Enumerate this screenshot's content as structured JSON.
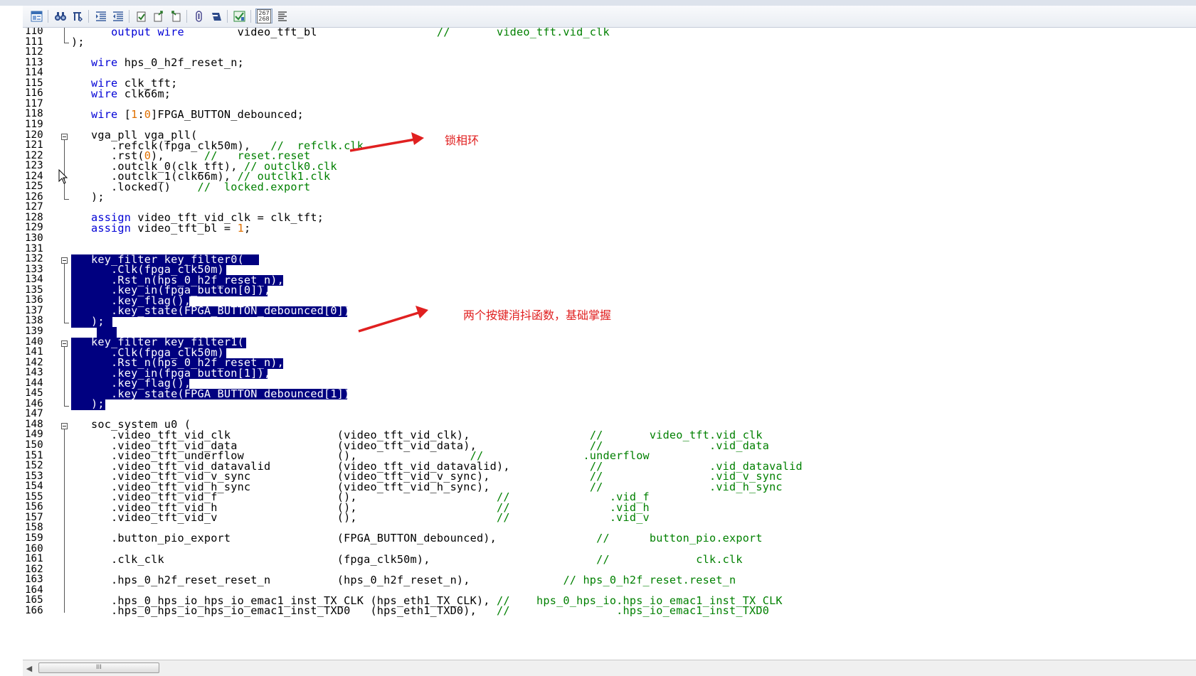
{
  "toolbar": {
    "buttons": [
      {
        "name": "project-icon",
        "color": "#3a6fb5"
      },
      {
        "name": "find-icon",
        "color": "#2c4a8a"
      },
      {
        "name": "find-replace-icon",
        "color": "#2c4a8a"
      },
      {
        "name": "indent-icon",
        "color": "#3a5fa0"
      },
      {
        "name": "unindent-icon",
        "color": "#3a5fa0"
      },
      {
        "name": "bookmark-icon",
        "color": "#2a7a2a"
      },
      {
        "name": "bookmark-next-icon",
        "color": "#2a7a2a"
      },
      {
        "name": "bookmark-prev-icon",
        "color": "#2a7a2a"
      },
      {
        "name": "insert-template-icon",
        "color": "#4a4a90"
      },
      {
        "name": "block-comment-icon",
        "color": "#2c4a8a"
      },
      {
        "name": "check-syntax-icon",
        "color": "#2a8a3a"
      },
      {
        "name": "line-numbers-icon",
        "color": "#333"
      },
      {
        "name": "word-wrap-icon",
        "color": "#333"
      }
    ],
    "line_numbers_label_top": "267",
    "line_numbers_label_bottom": "268"
  },
  "editor": {
    "line_numbers": [
      "110",
      "111",
      "112",
      "113",
      "114",
      "115",
      "116",
      "117",
      "118",
      "119",
      "120",
      "121",
      "122",
      "123",
      "124",
      "125",
      "126",
      "127",
      "128",
      "129",
      "130",
      "131",
      "132",
      "133",
      "134",
      "135",
      "136",
      "137",
      "138",
      "139",
      "140",
      "141",
      "142",
      "143",
      "144",
      "145",
      "146",
      "147",
      "148",
      "149",
      "150",
      "151",
      "152",
      "153",
      "154",
      "155",
      "156",
      "157",
      "158",
      "159",
      "160",
      "161",
      "162",
      "163",
      "164",
      "165",
      "166"
    ],
    "lines": [
      [
        {
          "t": "      ",
          "c": ""
        },
        {
          "t": "output wire",
          "c": "kw"
        },
        {
          "t": "        video_tft_bl                  ",
          "c": ""
        },
        {
          "t": "//       video_tft.vid_clk",
          "c": "cm"
        }
      ],
      [
        {
          "t": ");",
          "c": ""
        }
      ],
      [],
      [
        {
          "t": "   ",
          "c": ""
        },
        {
          "t": "wire",
          "c": "kw"
        },
        {
          "t": " hps_0_h2f_reset_n;",
          "c": ""
        }
      ],
      [],
      [
        {
          "t": "   ",
          "c": ""
        },
        {
          "t": "wire",
          "c": "kw"
        },
        {
          "t": " clk_tft;",
          "c": ""
        }
      ],
      [
        {
          "t": "   ",
          "c": ""
        },
        {
          "t": "wire",
          "c": "kw"
        },
        {
          "t": " clk66m;",
          "c": ""
        }
      ],
      [],
      [
        {
          "t": "   ",
          "c": ""
        },
        {
          "t": "wire",
          "c": "kw"
        },
        {
          "t": " [",
          "c": ""
        },
        {
          "t": "1",
          "c": "nm"
        },
        {
          "t": ":",
          "c": ""
        },
        {
          "t": "0",
          "c": "nm"
        },
        {
          "t": "]FPGA_BUTTON_debounced;",
          "c": ""
        }
      ],
      [],
      [
        {
          "t": "   vga_pll vga_pll(",
          "c": ""
        }
      ],
      [
        {
          "t": "      .refclk(fpga_clk50m),   ",
          "c": ""
        },
        {
          "t": "//  refclk.clk",
          "c": "cm"
        }
      ],
      [
        {
          "t": "      .rst(",
          "c": ""
        },
        {
          "t": "0",
          "c": "nm"
        },
        {
          "t": "),      ",
          "c": ""
        },
        {
          "t": "//   reset.reset",
          "c": "cm"
        }
      ],
      [
        {
          "t": "      .outclk_0(clk_tft), ",
          "c": ""
        },
        {
          "t": "// outclk0.clk",
          "c": "cm"
        }
      ],
      [
        {
          "t": "      .outclk_1(clk66m), ",
          "c": ""
        },
        {
          "t": "// outclk1.clk",
          "c": "cm"
        }
      ],
      [
        {
          "t": "      .locked()    ",
          "c": ""
        },
        {
          "t": "//  locked.export",
          "c": "cm"
        }
      ],
      [
        {
          "t": "   );",
          "c": ""
        }
      ],
      [],
      [
        {
          "t": "   ",
          "c": ""
        },
        {
          "t": "assign",
          "c": "kw"
        },
        {
          "t": " video_tft_vid_clk = clk_tft;",
          "c": ""
        }
      ],
      [
        {
          "t": "   ",
          "c": ""
        },
        {
          "t": "assign",
          "c": "kw"
        },
        {
          "t": " video_tft_bl = ",
          "c": ""
        },
        {
          "t": "1",
          "c": "nm"
        },
        {
          "t": ";",
          "c": ""
        }
      ],
      [],
      [],
      [
        {
          "t": "   key_filter key_filter0(",
          "c": "selx"
        }
      ],
      [
        {
          "t": "      .Clk(fpga_clk50m),",
          "c": "selx"
        }
      ],
      [
        {
          "t": "      .Rst_n(hps_0_h2f_reset_n),",
          "c": "selx"
        }
      ],
      [
        {
          "t": "      .key_in(fpga_button[0]),",
          "c": "selx"
        }
      ],
      [
        {
          "t": "      .key_flag(),",
          "c": "selx"
        }
      ],
      [
        {
          "t": "      .key_state(FPGA_BUTTON_debounced[0])",
          "c": "selx"
        }
      ],
      [
        {
          "t": "   );",
          "c": "selx"
        }
      ],
      [],
      [
        {
          "t": "   key_filter key_filter1(",
          "c": "selx"
        }
      ],
      [
        {
          "t": "      .Clk(fpga_clk50m),",
          "c": "selx"
        }
      ],
      [
        {
          "t": "      .Rst_n(hps_0_h2f_reset_n),",
          "c": "selx"
        }
      ],
      [
        {
          "t": "      .key_in(fpga_button[1]),",
          "c": "selx"
        }
      ],
      [
        {
          "t": "      .key_flag(),",
          "c": "selx"
        }
      ],
      [
        {
          "t": "      .key_state(FPGA_BUTTON_debounced[1])",
          "c": "selx"
        }
      ],
      [
        {
          "t": "   );",
          "c": "selx"
        }
      ],
      [],
      [
        {
          "t": "   soc_system u0 (",
          "c": ""
        }
      ],
      [
        {
          "t": "      .video_tft_vid_clk                (video_tft_vid_clk),                  ",
          "c": ""
        },
        {
          "t": "//       video_tft.vid_clk",
          "c": "cm"
        }
      ],
      [
        {
          "t": "      .video_tft_vid_data               (video_tft_vid_data),                 ",
          "c": ""
        },
        {
          "t": "//                .vid_data",
          "c": "cm"
        }
      ],
      [
        {
          "t": "      .video_tft_underflow              (),                 ",
          "c": ""
        },
        {
          "t": "//               .underflow",
          "c": "cm"
        }
      ],
      [
        {
          "t": "      .video_tft_vid_datavalid          (video_tft_vid_datavalid),            ",
          "c": ""
        },
        {
          "t": "//                .vid_datavalid",
          "c": "cm"
        }
      ],
      [
        {
          "t": "      .video_tft_vid_v_sync             (video_tft_vid_v_sync),               ",
          "c": ""
        },
        {
          "t": "//                .vid_v_sync",
          "c": "cm"
        }
      ],
      [
        {
          "t": "      .video_tft_vid_h_sync             (video_tft_vid_h_sync),               ",
          "c": ""
        },
        {
          "t": "//                .vid_h_sync",
          "c": "cm"
        }
      ],
      [
        {
          "t": "      .video_tft_vid_f                  (),                     ",
          "c": ""
        },
        {
          "t": "//               .vid_f",
          "c": "cm"
        }
      ],
      [
        {
          "t": "      .video_tft_vid_h                  (),                     ",
          "c": ""
        },
        {
          "t": "//               .vid_h",
          "c": "cm"
        }
      ],
      [
        {
          "t": "      .video_tft_vid_v                  (),                     ",
          "c": ""
        },
        {
          "t": "//               .vid_v",
          "c": "cm"
        }
      ],
      [],
      [
        {
          "t": "      .button_pio_export                (FPGA_BUTTON_debounced),               ",
          "c": ""
        },
        {
          "t": "//      button_pio.export",
          "c": "cm"
        }
      ],
      [],
      [
        {
          "t": "      .clk_clk                          (fpga_clk50m),                         ",
          "c": ""
        },
        {
          "t": "//             clk.clk",
          "c": "cm"
        }
      ],
      [],
      [
        {
          "t": "      .hps_0_h2f_reset_reset_n          (hps_0_h2f_reset_n),              ",
          "c": ""
        },
        {
          "t": "// hps_0_h2f_reset.reset_n",
          "c": "cm"
        }
      ],
      [],
      [
        {
          "t": "      .hps_0_hps_io_hps_io_emac1_inst_TX_CLK (hps_eth1_TX_CLK), ",
          "c": ""
        },
        {
          "t": "//    hps_0_hps_io.hps_io_emac1_inst_TX_CLK",
          "c": "cm"
        }
      ],
      [
        {
          "t": "      .hps_0_hps_io_hps_io_emac1_inst_TXD0   (hps_eth1_TXD0),   ",
          "c": ""
        },
        {
          "t": "//                .hps_io_emac1_inst_TXD0",
          "c": "cm"
        }
      ]
    ]
  },
  "annotations": {
    "note1": "锁相环",
    "note2": "两个按键消抖函数，基础掌握",
    "arrow_color": "#e02020"
  },
  "scrollbar": {
    "grip": "III"
  }
}
